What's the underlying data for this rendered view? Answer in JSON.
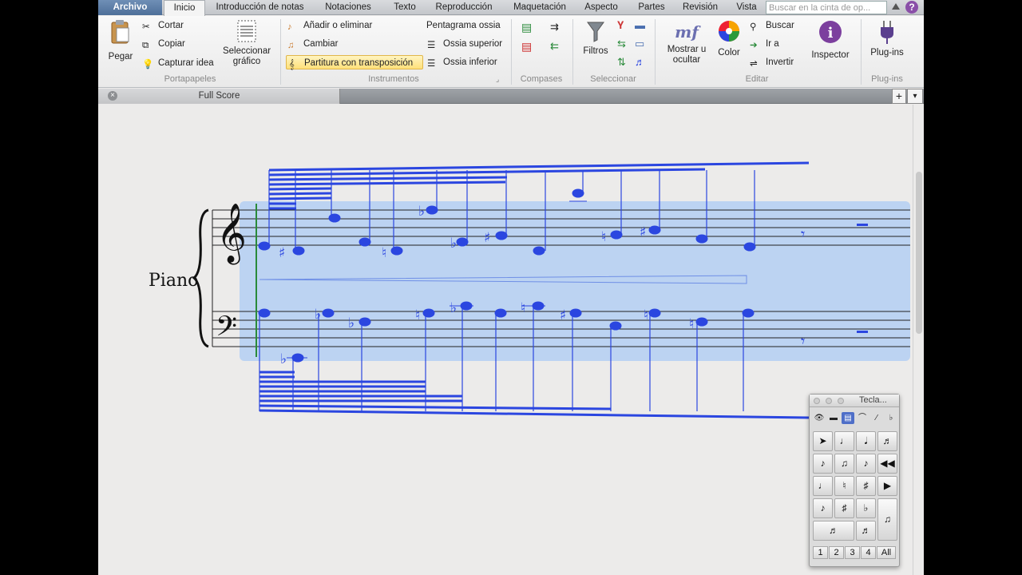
{
  "tabs": [
    "Archivo",
    "Inicio",
    "Introducción de notas",
    "Notaciones",
    "Texto",
    "Reproducción",
    "Maquetación",
    "Aspecto",
    "Partes",
    "Revisión",
    "Vista"
  ],
  "search": {
    "placeholder": "Buscar en la cinta de op..."
  },
  "help_label": "?",
  "ribbon": {
    "clipboard": {
      "paste": "Pegar",
      "cut": "Cortar",
      "copy": "Copiar",
      "capture": "Capturar idea",
      "label": "Portapapeles"
    },
    "select_graphic": {
      "line1": "Seleccionar",
      "line2": "gráfico"
    },
    "instruments": {
      "add_remove": "Añadir o eliminar",
      "change": "Cambiar",
      "transposing": "Partitura con transposición",
      "ossia_staff": "Pentagrama ossia",
      "ossia_above": "Ossia superior",
      "ossia_below": "Ossia inferior",
      "label": "Instrumentos"
    },
    "bars": {
      "label": "Compases"
    },
    "select": {
      "filters": "Filtros",
      "label": "Seleccionar"
    },
    "edit": {
      "show_hide_1": "Mostrar u",
      "show_hide_2": "ocultar",
      "color": "Color",
      "find": "Buscar",
      "goto": "Ir a",
      "invert": "Invertir",
      "inspector": "Inspector",
      "label": "Editar"
    },
    "plugins": {
      "button": "Plug-ins",
      "label": "Plug-ins"
    }
  },
  "score_tab": {
    "title": "Full Score",
    "add": "+"
  },
  "score": {
    "instrument": "Piano"
  },
  "keypad": {
    "title": "Tecla...",
    "layouts": [
      "1",
      "2",
      "3",
      "4",
      "All"
    ]
  },
  "colors": {
    "accent": "#2b46e0",
    "selection": "#b9d1f2",
    "brand": "#5573a0"
  }
}
